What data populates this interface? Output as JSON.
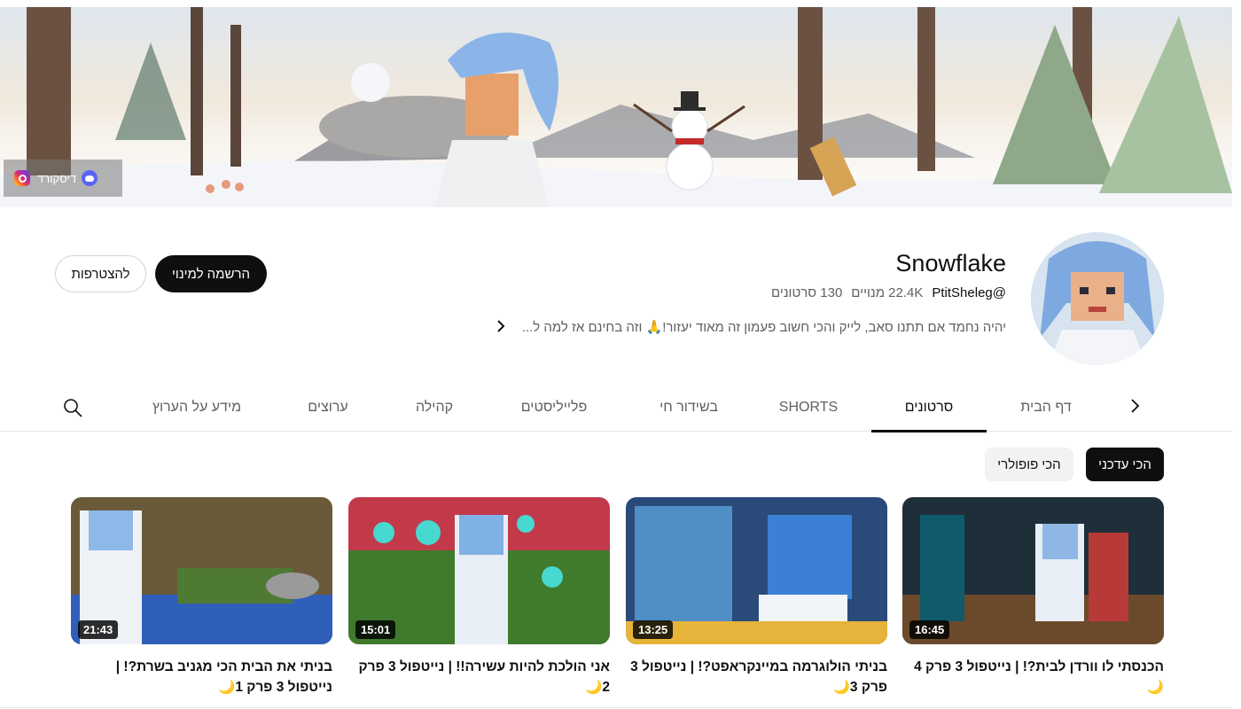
{
  "banner": {
    "links": [
      {
        "label": "דיסקורד",
        "icon": "discord-icon"
      },
      {
        "label": "",
        "icon": "instagram-icon"
      }
    ]
  },
  "channel": {
    "name": "Snowflake",
    "handle": "@PtitSheleg",
    "subscribers": "22.4K מנויים",
    "video_count": "130 סרטונים",
    "description": "יהיה נחמד אם תתנו סאב, לייק והכי חשוב פעמון זה מאוד יעזור!🙏 וזה בחינם אז למה ל...",
    "subscribe_label": "הרשמה למינוי",
    "join_label": "להצטרפות"
  },
  "tabs": [
    {
      "label": "דף הבית",
      "active": false
    },
    {
      "label": "סרטונים",
      "active": true
    },
    {
      "label": "SHORTS",
      "active": false
    },
    {
      "label": "בשידור חי",
      "active": false
    },
    {
      "label": "פלייליסטים",
      "active": false
    },
    {
      "label": "קהילה",
      "active": false
    },
    {
      "label": "ערוצים",
      "active": false
    },
    {
      "label": "מידע על הערוץ",
      "active": false
    }
  ],
  "chips": {
    "latest": "הכי עדכני",
    "popular": "הכי פופולרי"
  },
  "videos": [
    {
      "title": "הכנסתי לו וורדן לבית?! | נייטפול 3 פרק 4 🌙",
      "duration": "16:45"
    },
    {
      "title": "בניתי הולוגרמה במיינקראפט?! | נייטפול 3 פרק 3🌙",
      "duration": "13:25"
    },
    {
      "title": "אני הולכת להיות עשירה!! | נייטפול 3 פרק 2🌙",
      "duration": "15:01"
    },
    {
      "title": "בניתי את הבית הכי מגניב בשרת?! | נייטפול 3 פרק 1🌙",
      "duration": "21:43"
    }
  ],
  "colors": {
    "accent": "#0f0f0f",
    "muted": "#606060",
    "chip_bg": "#f2f2f2"
  }
}
